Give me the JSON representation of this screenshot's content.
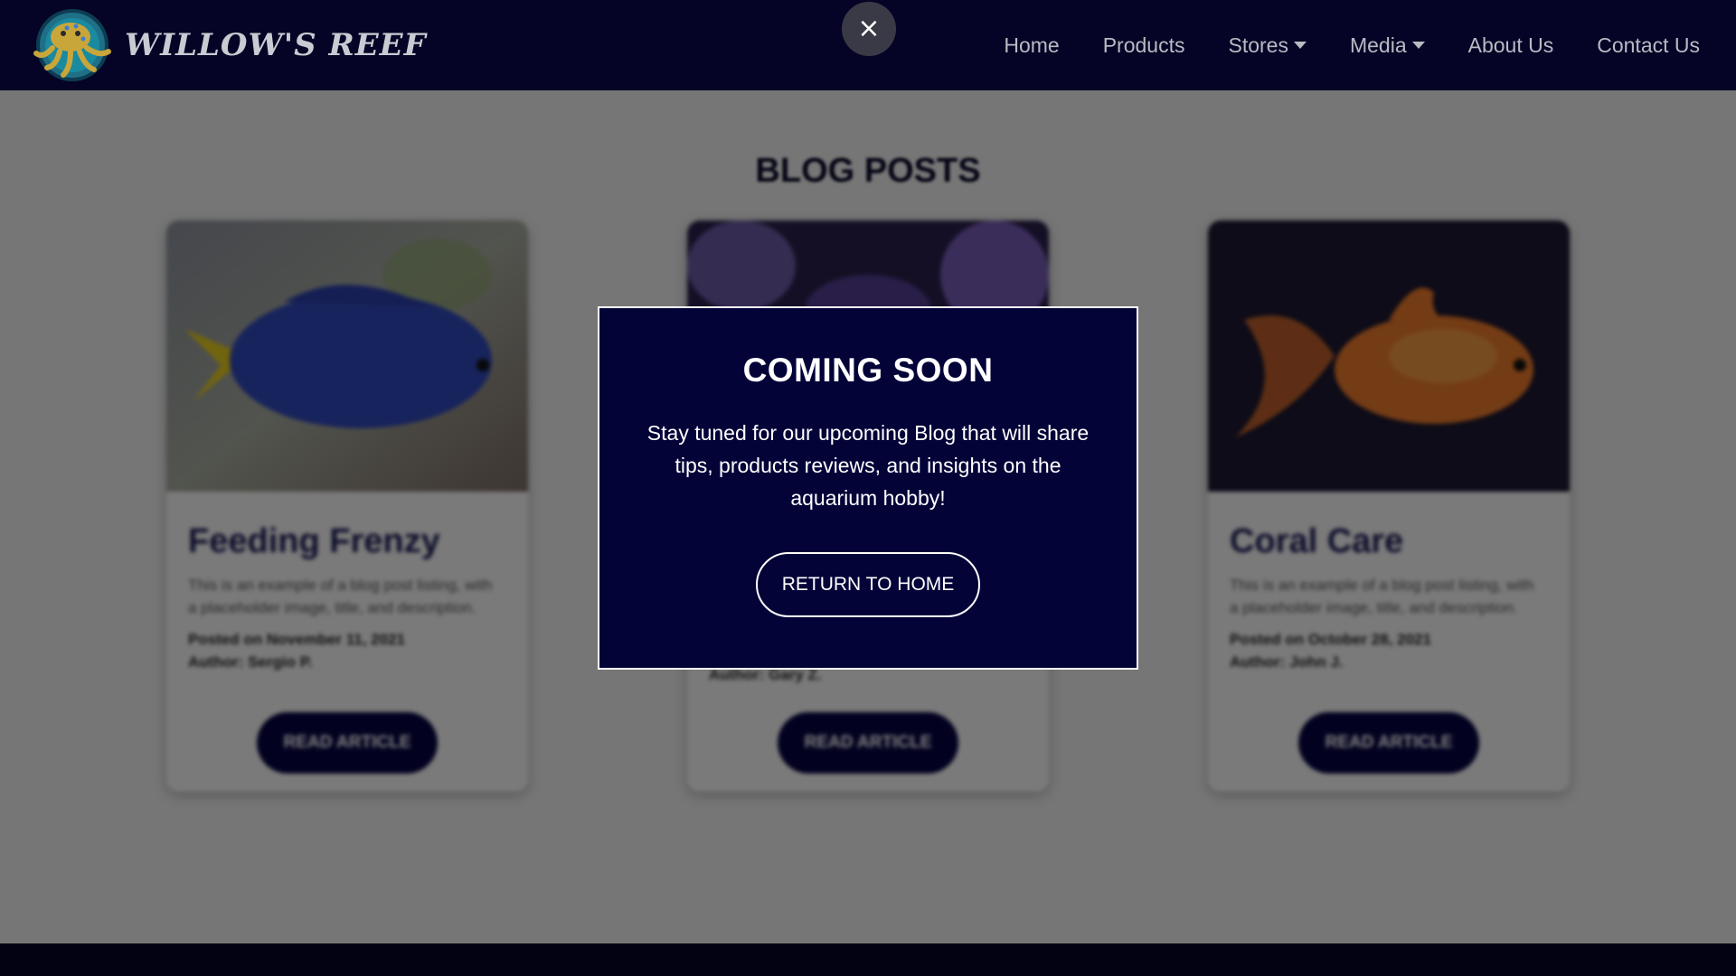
{
  "brand": {
    "name": "WILLOW'S REEF"
  },
  "nav": {
    "items": [
      {
        "label": "Home",
        "dropdown": false
      },
      {
        "label": "Products",
        "dropdown": false
      },
      {
        "label": "Stores",
        "dropdown": true
      },
      {
        "label": "Media",
        "dropdown": true
      },
      {
        "label": "About Us",
        "dropdown": false
      },
      {
        "label": "Contact Us",
        "dropdown": false
      }
    ]
  },
  "close_button": {
    "glyph": "×"
  },
  "page": {
    "title": "BLOG POSTS",
    "cards": [
      {
        "title": "Feeding Frenzy",
        "description": "This is an example of a blog post listing, with a placeholder image, title, and description.",
        "posted": "Posted on November 11, 2021",
        "author": "Author: Sergio P.",
        "button": "READ ARTICLE",
        "image": "blue-fish"
      },
      {
        "title": "",
        "description": "",
        "posted": "",
        "author": "Author: Gary Z.",
        "button": "READ ARTICLE",
        "image": "purple-coral"
      },
      {
        "title": "Coral Care",
        "description": "This is an example of a blog post listing, with a placeholder image, title, and description.",
        "posted": "Posted on October 28, 2021",
        "author": "Author: John J.",
        "button": "READ ARTICLE",
        "image": "goldfish"
      }
    ]
  },
  "modal": {
    "title": "COMING SOON",
    "text": "Stay tuned for our upcoming Blog that will share tips, products reviews, and insights on the aquarium hobby!",
    "button": "RETURN TO HOME"
  },
  "colors": {
    "header_bg": "#050426",
    "modal_bg": "#030338",
    "button_bg": "#050440",
    "nav_text": "#b9bac4"
  }
}
